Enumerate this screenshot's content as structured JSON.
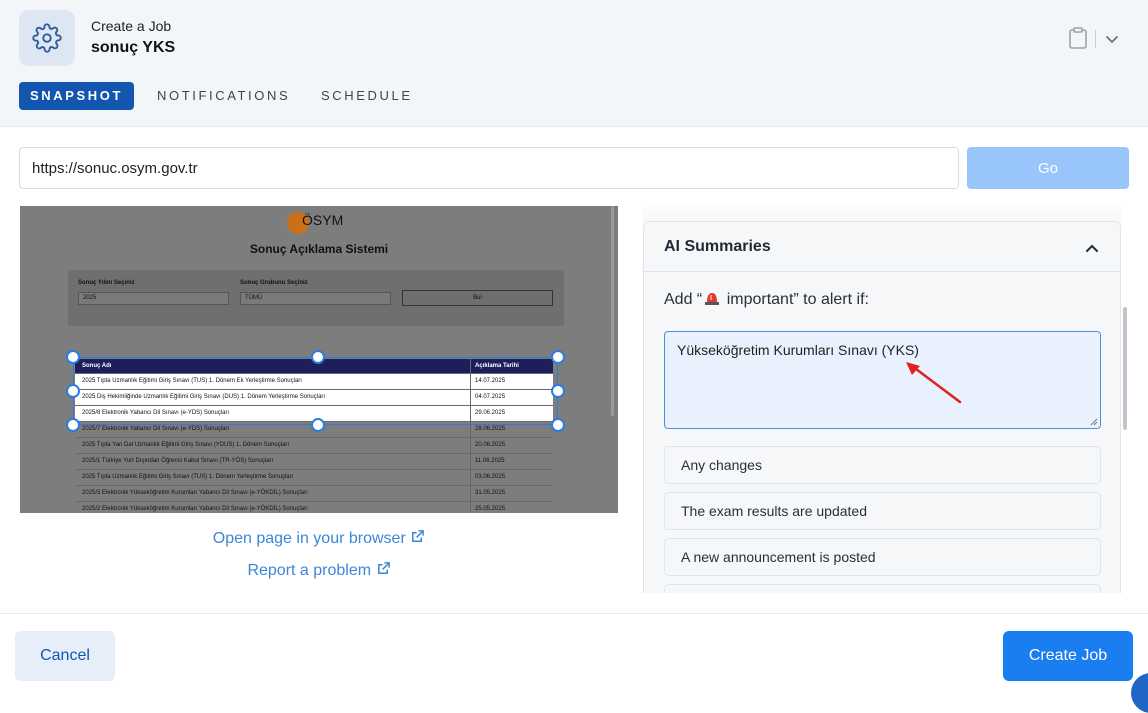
{
  "header": {
    "subtitle": "Create a Job",
    "job_title": "sonuç YKS",
    "tabs": [
      {
        "label": "SNAPSHOT",
        "active": true
      },
      {
        "label": "NOTIFICATIONS",
        "active": false
      },
      {
        "label": "SCHEDULE",
        "active": false
      }
    ],
    "icons": {
      "settings": "gear-icon",
      "clipboard": "clipboard-icon",
      "menu": "chevron-down-icon"
    }
  },
  "url_bar": {
    "value": "https://sonuc.osym.gov.tr",
    "go_label": "Go"
  },
  "snapshot": {
    "logo_text": "ÖSYM",
    "heading": "Sonuç Açıklama Sistemi",
    "year_label": "Sonuç Yılını Seçiniz",
    "year_value": "2025",
    "group_label": "Sonuç Grubunu Seçiniz",
    "group_value": "TÜMÜ",
    "search_button": "Bul",
    "table_headers": [
      "Sonuç Adı",
      "Açıklama Tarihi"
    ],
    "rows": [
      {
        "name": "2025 Tıpta Uzmanlık Eğitimi Giriş Sınavı (TUS) 1. Dönem Ek Yerleştirme Sonuçları",
        "date": "14.07.2025"
      },
      {
        "name": "2025 Diş Hekimliğinde Uzmanlık Eğitimi Giriş Sınavı (DUS) 1. Dönem Yerleştirme Sonuçları",
        "date": "04.07.2025"
      },
      {
        "name": "2025/8 Elektronik Yabancı Dil Sınavı (e-YDS) Sonuçları",
        "date": "29.06.2025"
      },
      {
        "name": "2025/7 Elektronik Yabancı Dil Sınavı (e-YDS) Sonuçları",
        "date": "28.06.2025"
      },
      {
        "name": "2025 Tıpta Yan Dal Uzmanlık Eğitimi Giriş Sınavı (YDUS) 1. Dönem Sonuçları",
        "date": "20.06.2025"
      },
      {
        "name": "2025/1 Türkiye Yurt Dışından Öğrenci Kabul Sınavı (TR-YÖS) Sonuçları",
        "date": "11.06.2025"
      },
      {
        "name": "2025 Tıpta Uzmanlık Eğitimi Giriş Sınavı (TUS) 1. Dönem Yerleştirme Sonuçları",
        "date": "03.06.2025"
      },
      {
        "name": "2025/3 Elektronik Yükseköğretim Kurumları Yabancı Dil Sınavı (e-YÖKDİL) Sonuçları",
        "date": "31.05.2025"
      },
      {
        "name": "2025/2 Elektronik Yükseköğretim Kurumları Yabancı Dil Sınavı (e-YÖKDİL) Sonuçları",
        "date": "25.05.2025"
      }
    ]
  },
  "links": {
    "open_browser": "Open page in your browser",
    "report_problem": "Report a problem"
  },
  "ai": {
    "title": "AI Summaries",
    "alert_prefix": "Add “",
    "alert_suffix": " important” to alert if:",
    "condition": "Yükseköğretim Kurumları Sınavı (YKS)",
    "options": [
      "Any changes",
      "The exam results are updated",
      "A new announcement is posted",
      ""
    ]
  },
  "footer": {
    "cancel": "Cancel",
    "create": "Create Job"
  },
  "colors": {
    "accent": "#1a7ef0",
    "tab_active": "#1256b0",
    "go_disabled": "#99c6fa",
    "selection": "#2a7de1",
    "annotation_arrow": "#e0221b"
  }
}
